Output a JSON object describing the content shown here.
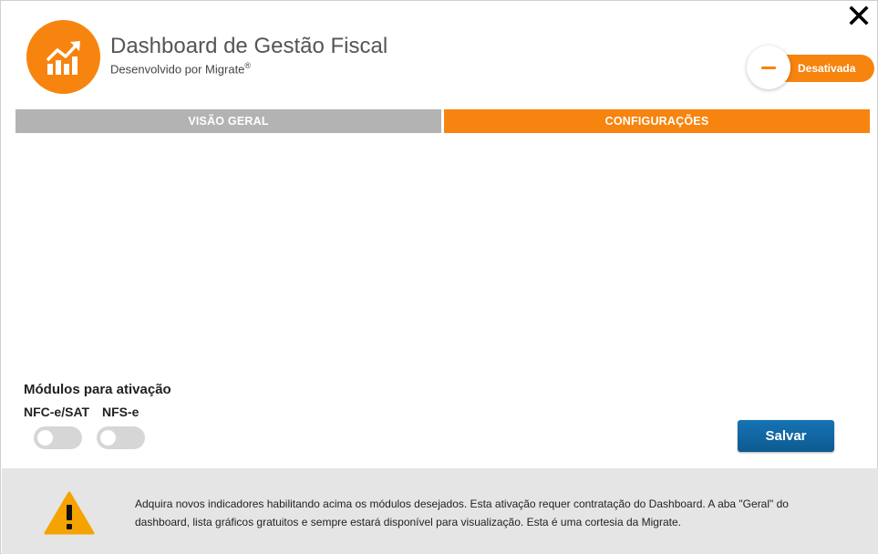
{
  "header": {
    "title": "Dashboard de Gestão Fiscal",
    "subtitle": "Desenvolvido por Migrate",
    "subtitle_mark": "®",
    "logo_icon": "chart-trend-up-icon",
    "close_icon": "close-icon"
  },
  "status": {
    "label": "Desativada",
    "state": "off"
  },
  "tabs": [
    {
      "label": "VISÃO GERAL",
      "active": false
    },
    {
      "label": "CONFIGURAÇÕES",
      "active": true
    }
  ],
  "modules": {
    "title": "Módulos para ativação",
    "items": [
      {
        "label": "NFC-e/SAT",
        "enabled": false
      },
      {
        "label": "NFS-e",
        "enabled": false
      }
    ]
  },
  "actions": {
    "save_label": "Salvar"
  },
  "footer": {
    "icon": "warning-icon",
    "message": "Adquira novos indicadores habilitando acima os módulos desejados. Esta ativação requer contratação do Dashboard. A aba \"Geral\" do dashboard, lista gráficos gratuitos e sempre estará disponível para visualização. Esta é uma cortesia da Migrate."
  },
  "colors": {
    "accent": "#f7840e",
    "tab_inactive": "#b3b3b3",
    "button": "#1673b4",
    "footer_bg": "#e5e5e5",
    "warning": "#f5a300"
  }
}
